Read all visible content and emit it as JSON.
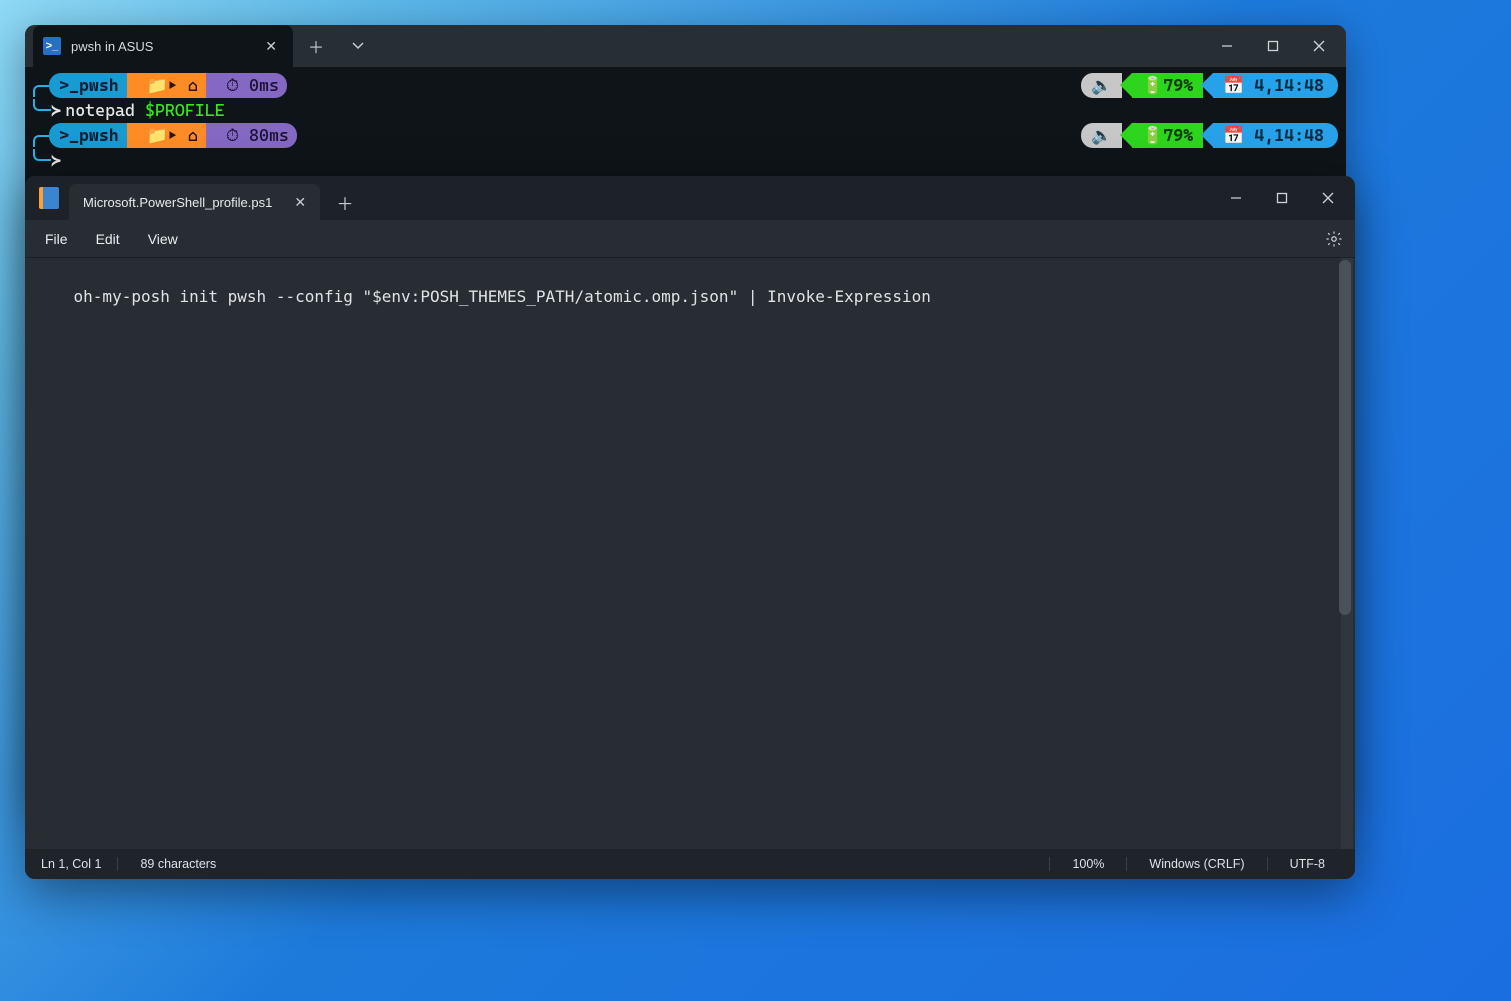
{
  "terminal": {
    "tab_title": "pwsh in ASUS",
    "prompt_segments": {
      "shell": ">_pwsh",
      "path_folder_arrow": "▸",
      "timing1": "⏱ 0ms",
      "timing2": "⏱ 80ms"
    },
    "right_segments": {
      "battery": "🔋79%",
      "clock": "📅 4,14:48"
    },
    "commands": [
      "notepad $PROFILE"
    ],
    "cmd_part1": "notepad",
    "cmd_part2": "$PROFILE"
  },
  "notepad": {
    "tab_title": "Microsoft.PowerShell_profile.ps1",
    "menu": {
      "file": "File",
      "edit": "Edit",
      "view": "View"
    },
    "content": "oh-my-posh init pwsh --config \"$env:POSH_THEMES_PATH/atomic.omp.json\" | Invoke-Expression",
    "status": {
      "position": "Ln 1, Col 1",
      "chars": "89 characters",
      "zoom": "100%",
      "eol": "Windows (CRLF)",
      "encoding": "UTF-8"
    }
  }
}
